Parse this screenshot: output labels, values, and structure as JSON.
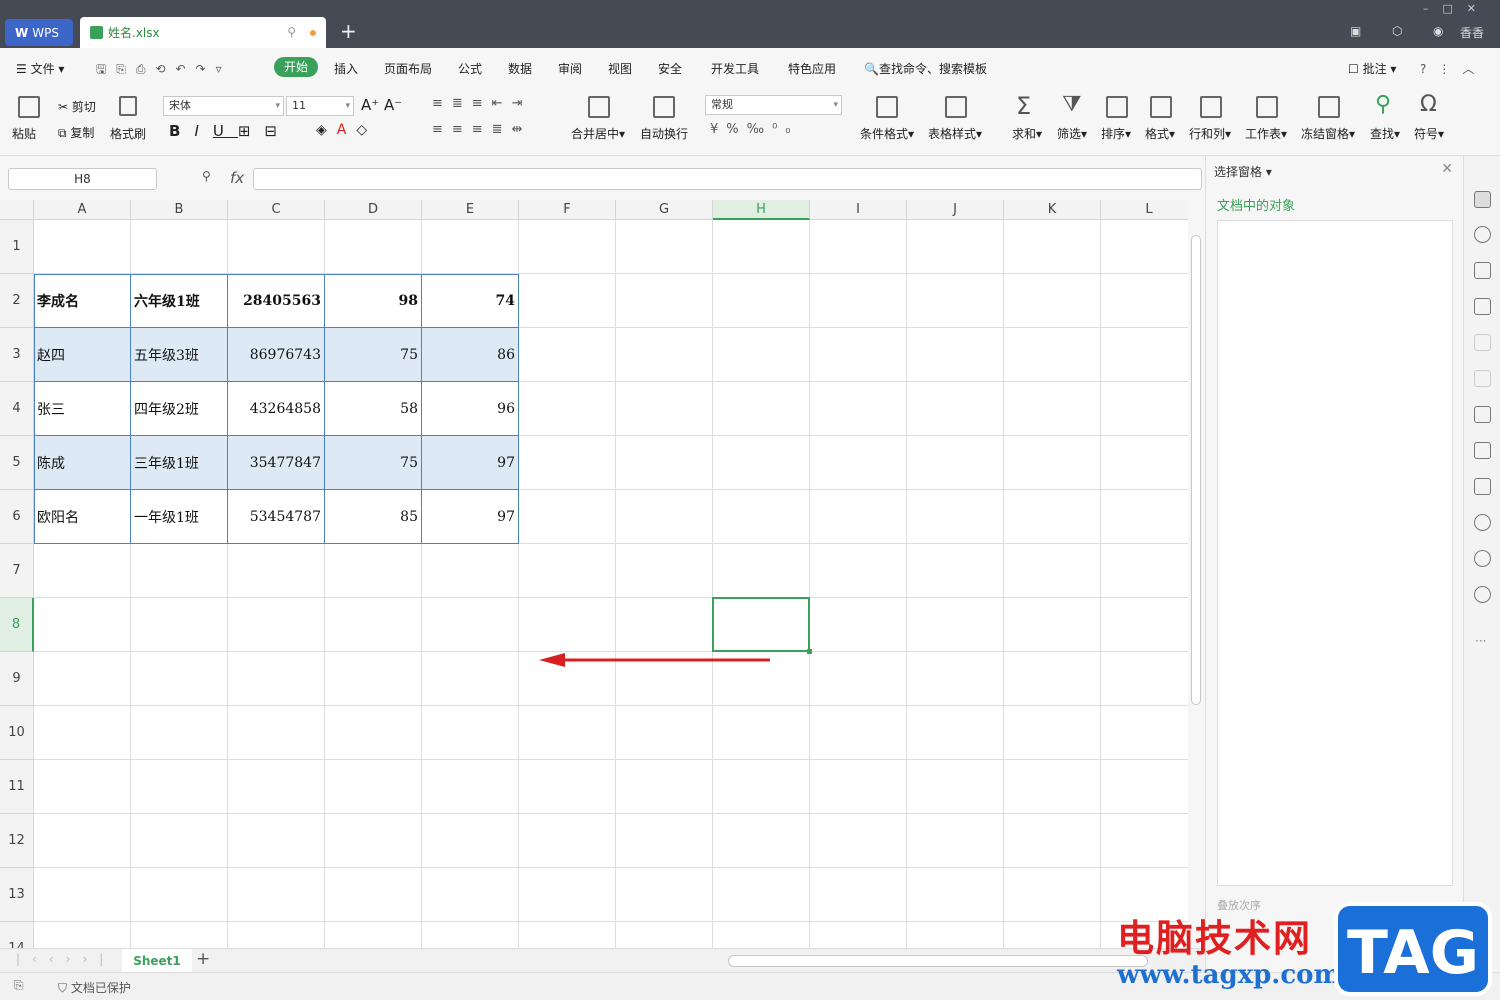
{
  "app": {
    "wps_tab": "WPS",
    "file_tab": "姓名.xlsx",
    "user_name": "香香"
  },
  "menu": {
    "file": "文件",
    "items": [
      "开始",
      "插入",
      "页面布局",
      "公式",
      "数据",
      "审阅",
      "视图",
      "安全",
      "开发工具",
      "特色应用"
    ],
    "search": "查找命令、搜索模板",
    "comment": "批注"
  },
  "ribbon": {
    "paste": "粘贴",
    "cut": "剪切",
    "copy": "复制",
    "format_painter": "格式刷",
    "font_name": "宋体",
    "font_size": "11",
    "merge_center": "合并居中",
    "wrap_text": "自动换行",
    "number_format": "常规",
    "conditional_format": "条件格式",
    "table_style": "表格样式",
    "sum": "求和",
    "filter": "筛选",
    "sort": "排序",
    "format": "格式",
    "rows_cols": "行和列",
    "worksheet": "工作表",
    "freeze": "冻结窗格",
    "find": "查找",
    "symbol": "符号"
  },
  "formula_bar": {
    "name_box": "H8",
    "fx": "fx",
    "content": ""
  },
  "grid": {
    "columns": [
      "A",
      "B",
      "C",
      "D",
      "E",
      "F",
      "G",
      "H",
      "I",
      "J",
      "K",
      "L"
    ],
    "rows": [
      "1",
      "2",
      "3",
      "4",
      "5",
      "6",
      "7",
      "8",
      "9",
      "10",
      "11",
      "12",
      "13",
      "14"
    ],
    "active_cell": "H8",
    "data": [
      [
        "李成名",
        "六年级1班",
        "28405563",
        "98",
        "74"
      ],
      [
        "赵四",
        "五年级3班",
        "86976743",
        "75",
        "86"
      ],
      [
        "张三",
        "四年级2班",
        "43264858",
        "58",
        "96"
      ],
      [
        "陈成",
        "三年级1班",
        "35477847",
        "75",
        "97"
      ],
      [
        "欧阳名",
        "一年级1班",
        "53454787",
        "85",
        "97"
      ]
    ]
  },
  "sheets": {
    "active": "Sheet1"
  },
  "status": {
    "protect": "文档已保护"
  },
  "side_panel": {
    "title": "选择窗格",
    "subtitle": "文档中的对象",
    "order_label": "叠放次序"
  },
  "watermark": {
    "line1": "电脑技术网",
    "line2": "www.tagxp.com",
    "logo": "TAG"
  },
  "colors": {
    "accent": "#3aa15a",
    "highlight": "#ddeaf6",
    "table_border": "#4a82c4",
    "arrow": "#d82020"
  }
}
